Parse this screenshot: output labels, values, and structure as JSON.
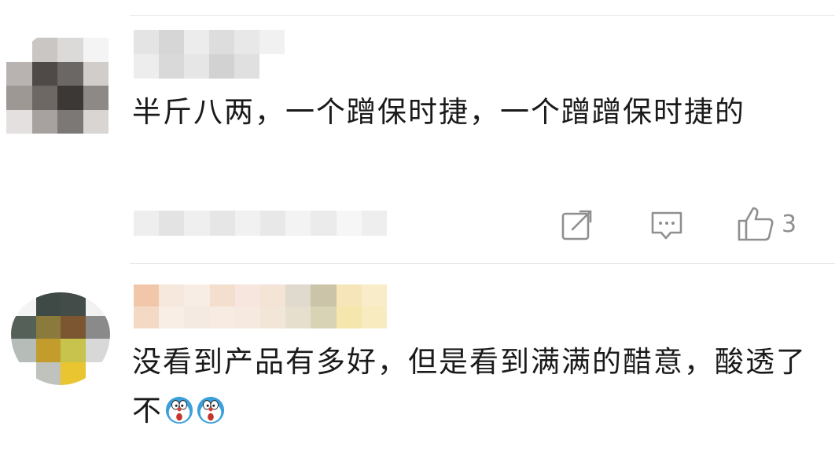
{
  "comments": [
    {
      "text": "半斤八两，一个蹭保时捷，一个蹭蹭保时捷的",
      "like_count": "3",
      "icons": [
        "share-icon",
        "reply-icon",
        "like-icon"
      ]
    },
    {
      "text": "没看到产品有多好，但是看到满满的醋意，酸透了不",
      "emojis": [
        "doraemon-emoji",
        "doraemon-emoji"
      ]
    }
  ],
  "colors": {
    "background": "#ffffff",
    "text": "#1a1a1a",
    "icon_gray": "#8f8f8f",
    "divider": "#e4e4e4"
  }
}
